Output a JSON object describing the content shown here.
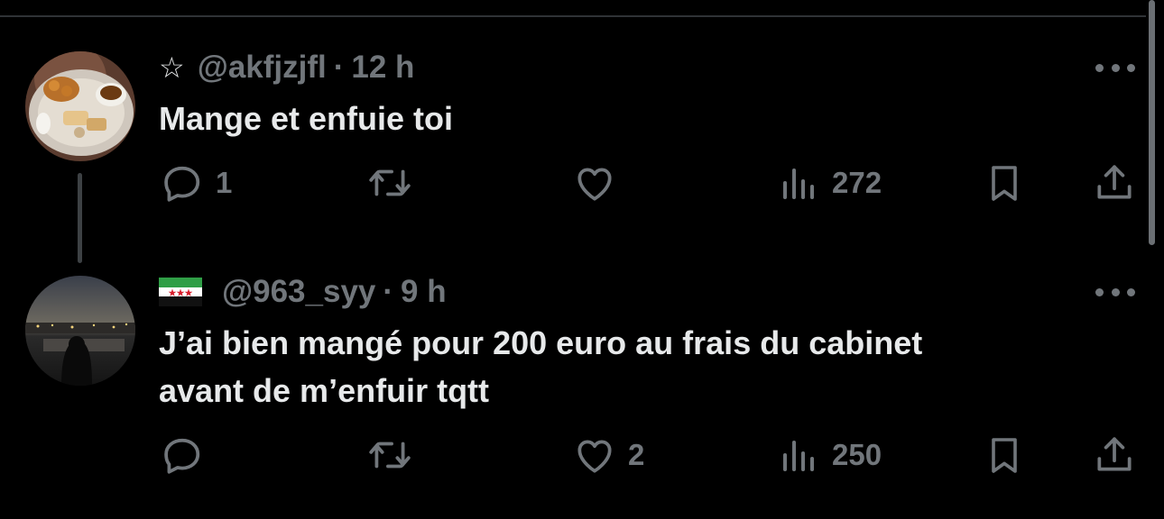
{
  "tweets": [
    {
      "prefix": "☆",
      "handle": "@akfjzjfl",
      "separator": "·",
      "time": "12 h",
      "text": "Mange et enfuie toi",
      "replies": "1",
      "retweets": "",
      "likes": "",
      "views": "272",
      "avatar": "food-plate-photo"
    },
    {
      "flag": "syrian-independence-flag",
      "handle": "@963_syy",
      "separator": "·",
      "time": "9 h",
      "text": "J’ai bien mangé pour 200 euro au frais du cabinet\navant de m’enfuir tqtt",
      "replies": "",
      "retweets": "",
      "likes": "2",
      "views": "250",
      "avatar": "night-city-photo"
    }
  ],
  "colors": {
    "background": "#000000",
    "text": "#e7e9ea",
    "secondary": "#71767b",
    "divider": "#2f3336"
  },
  "icons": [
    "reply-icon",
    "retweet-icon",
    "like-icon",
    "views-icon",
    "bookmark-icon",
    "share-icon",
    "more-icon"
  ]
}
